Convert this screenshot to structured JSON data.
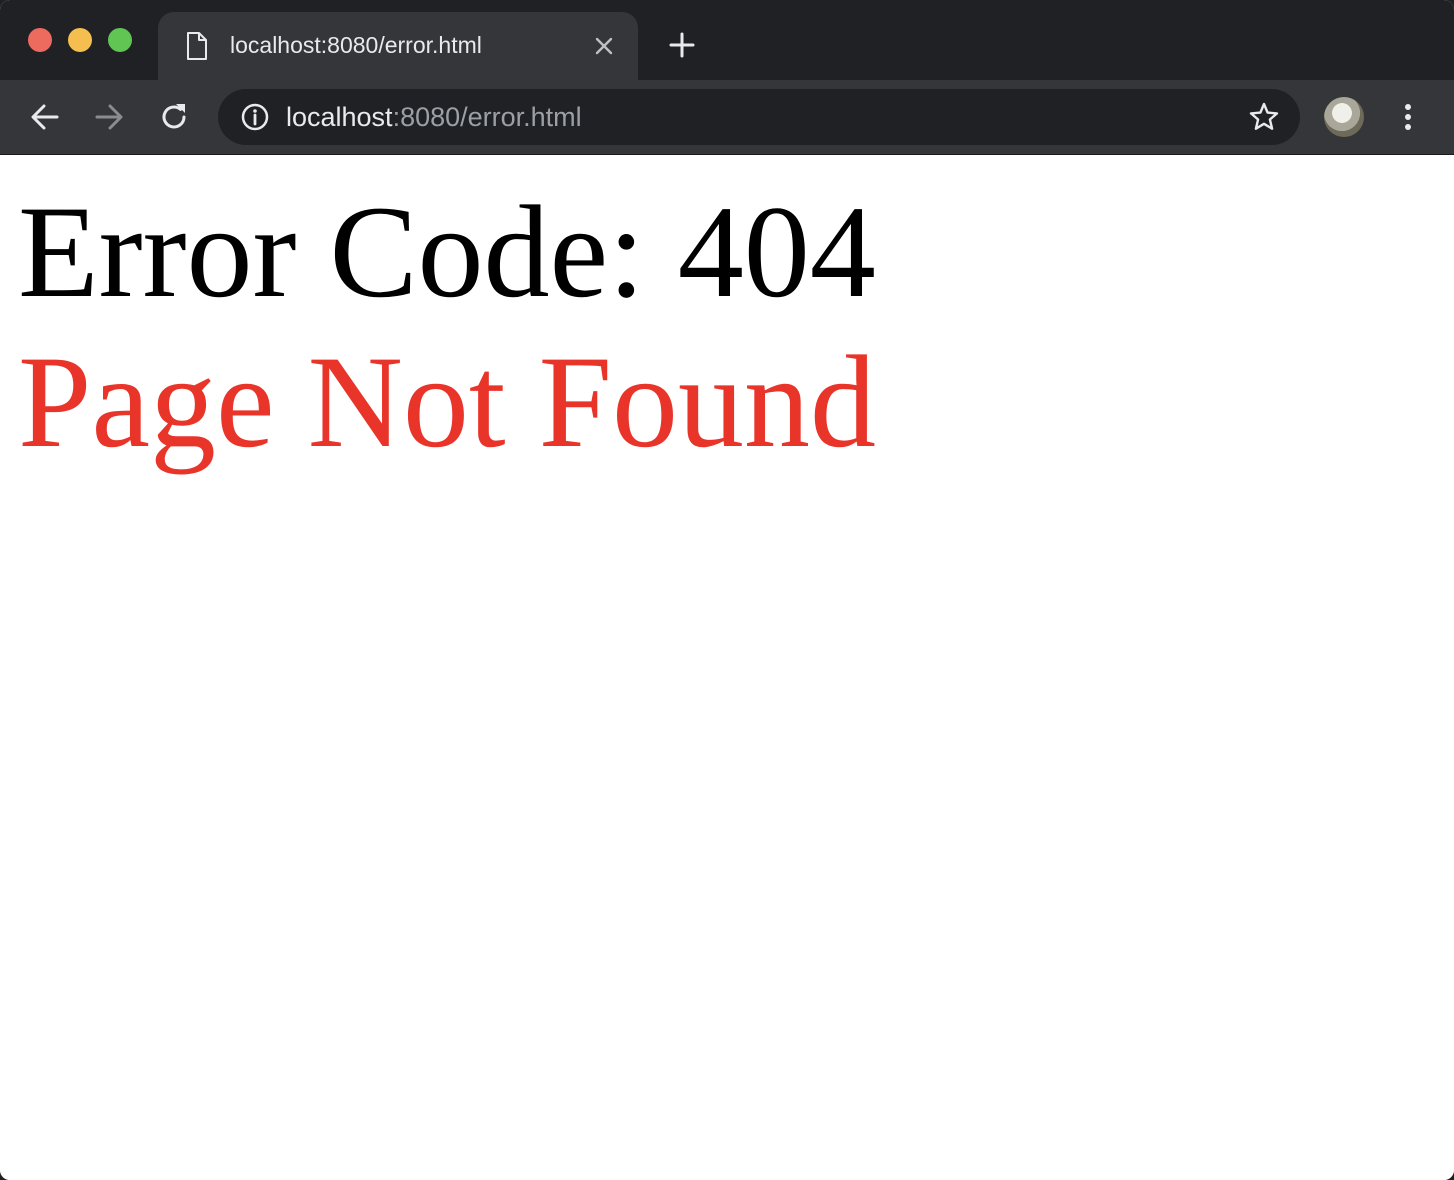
{
  "browser": {
    "tab": {
      "title": "localhost:8080/error.html",
      "icon": "document-icon"
    },
    "address_bar": {
      "host": "localhost",
      "path": ":8080/error.html",
      "security_icon": "info-icon"
    },
    "colors": {
      "close": "#ed6a5e",
      "minimize": "#f4bf4f",
      "maximize": "#61c554"
    }
  },
  "page": {
    "error_code": "Error Code: 404",
    "message": "Page Not Found",
    "message_color": "#e9342a"
  }
}
